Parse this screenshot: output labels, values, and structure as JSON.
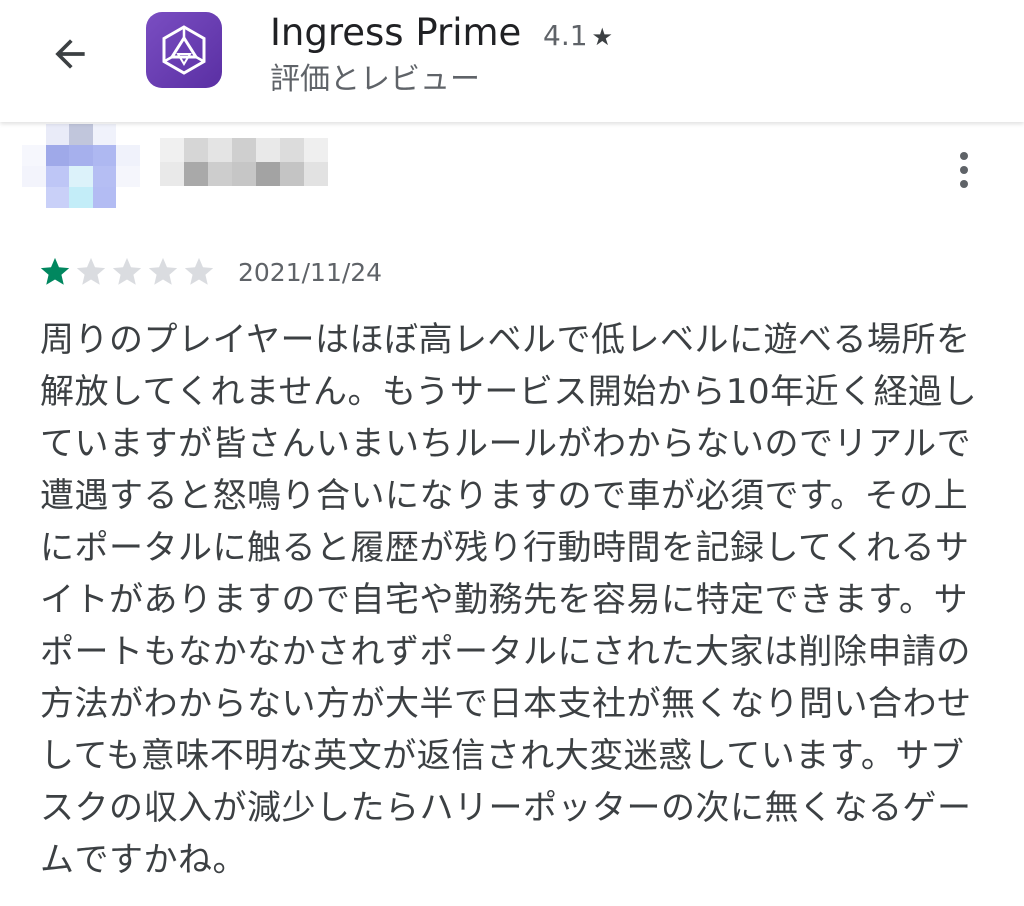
{
  "header": {
    "app_name": "Ingress Prime",
    "rating": "4.1",
    "rating_star": "★",
    "subtitle": "評価とレビュー",
    "icon": "ingress-logo-icon",
    "brand_color": "#6a3db5"
  },
  "review": {
    "stars_filled": 1,
    "stars_total": 5,
    "star_color_filled": "#01875f",
    "star_color_empty": "#dadce0",
    "date": "2021/11/24",
    "body": "周りのプレイヤーはほぼ高レベルで低レベルに遊べる場所を解放してくれません。もうサービス開始から10年近く経過していますが皆さんいまいちルールがわからないのでリアルで遭遇すると怒鳴り合いになりますので車が必須です。その上にポータルに触ると履歴が残り行動時間を記録してくれるサイトがありますので自宅や勤務先を容易に特定できます。サポートもなかなかされずポータルにされた大家は削除申請の方法がわからない方が大半で日本支社が無くなり問い合わせしても意味不明な英文が返信され大変迷惑しています。サブスクの収入が減少したらハリーポッターの次に無くなるゲームですかね。"
  },
  "icons": {
    "back": "arrow-back-icon",
    "more": "more-vert-icon"
  }
}
